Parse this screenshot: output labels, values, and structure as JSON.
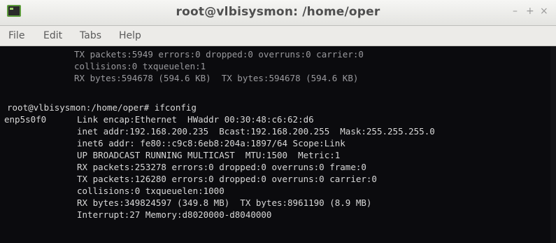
{
  "window": {
    "title": "root@vlbisysmon: /home/oper",
    "buttons": {
      "minimize": "–",
      "maximize": "+",
      "close": "×"
    }
  },
  "menu": {
    "items": [
      "File",
      "Edit",
      "Tabs",
      "Help"
    ]
  },
  "terminal": {
    "lines": [
      "TX packets:5949 errors:0 dropped:0 overruns:0 carrier:0",
      "collisions:0 txqueuelen:1",
      "RX bytes:594678 (594.6 KB)  TX bytes:594678 (594.6 KB)",
      "root@vlbisysmon:/home/oper# ifconfig",
      "enp5s0f0",
      "Link encap:Ethernet  HWaddr 00:30:48:c6:62:d6",
      "inet addr:192.168.200.235  Bcast:192.168.200.255  Mask:255.255.255.0",
      "inet6 addr: fe80::c9c8:6eb8:204a:1897/64 Scope:Link",
      "UP BROADCAST RUNNING MULTICAST  MTU:1500  Metric:1",
      "RX packets:253278 errors:0 dropped:0 overruns:0 frame:0",
      "TX packets:126280 errors:0 dropped:0 overruns:0 carrier:0",
      "collisions:0 txqueuelen:1000",
      "RX bytes:349824597 (349.8 MB)  TX bytes:8961190 (8.9 MB)",
      "Interrupt:27 Memory:d8020000-d8040000"
    ]
  },
  "colors": {
    "terminal_bg": "#0b0b0e",
    "terminal_text": "#d8d8d8",
    "titlebar_bg": "#eeeeec"
  }
}
